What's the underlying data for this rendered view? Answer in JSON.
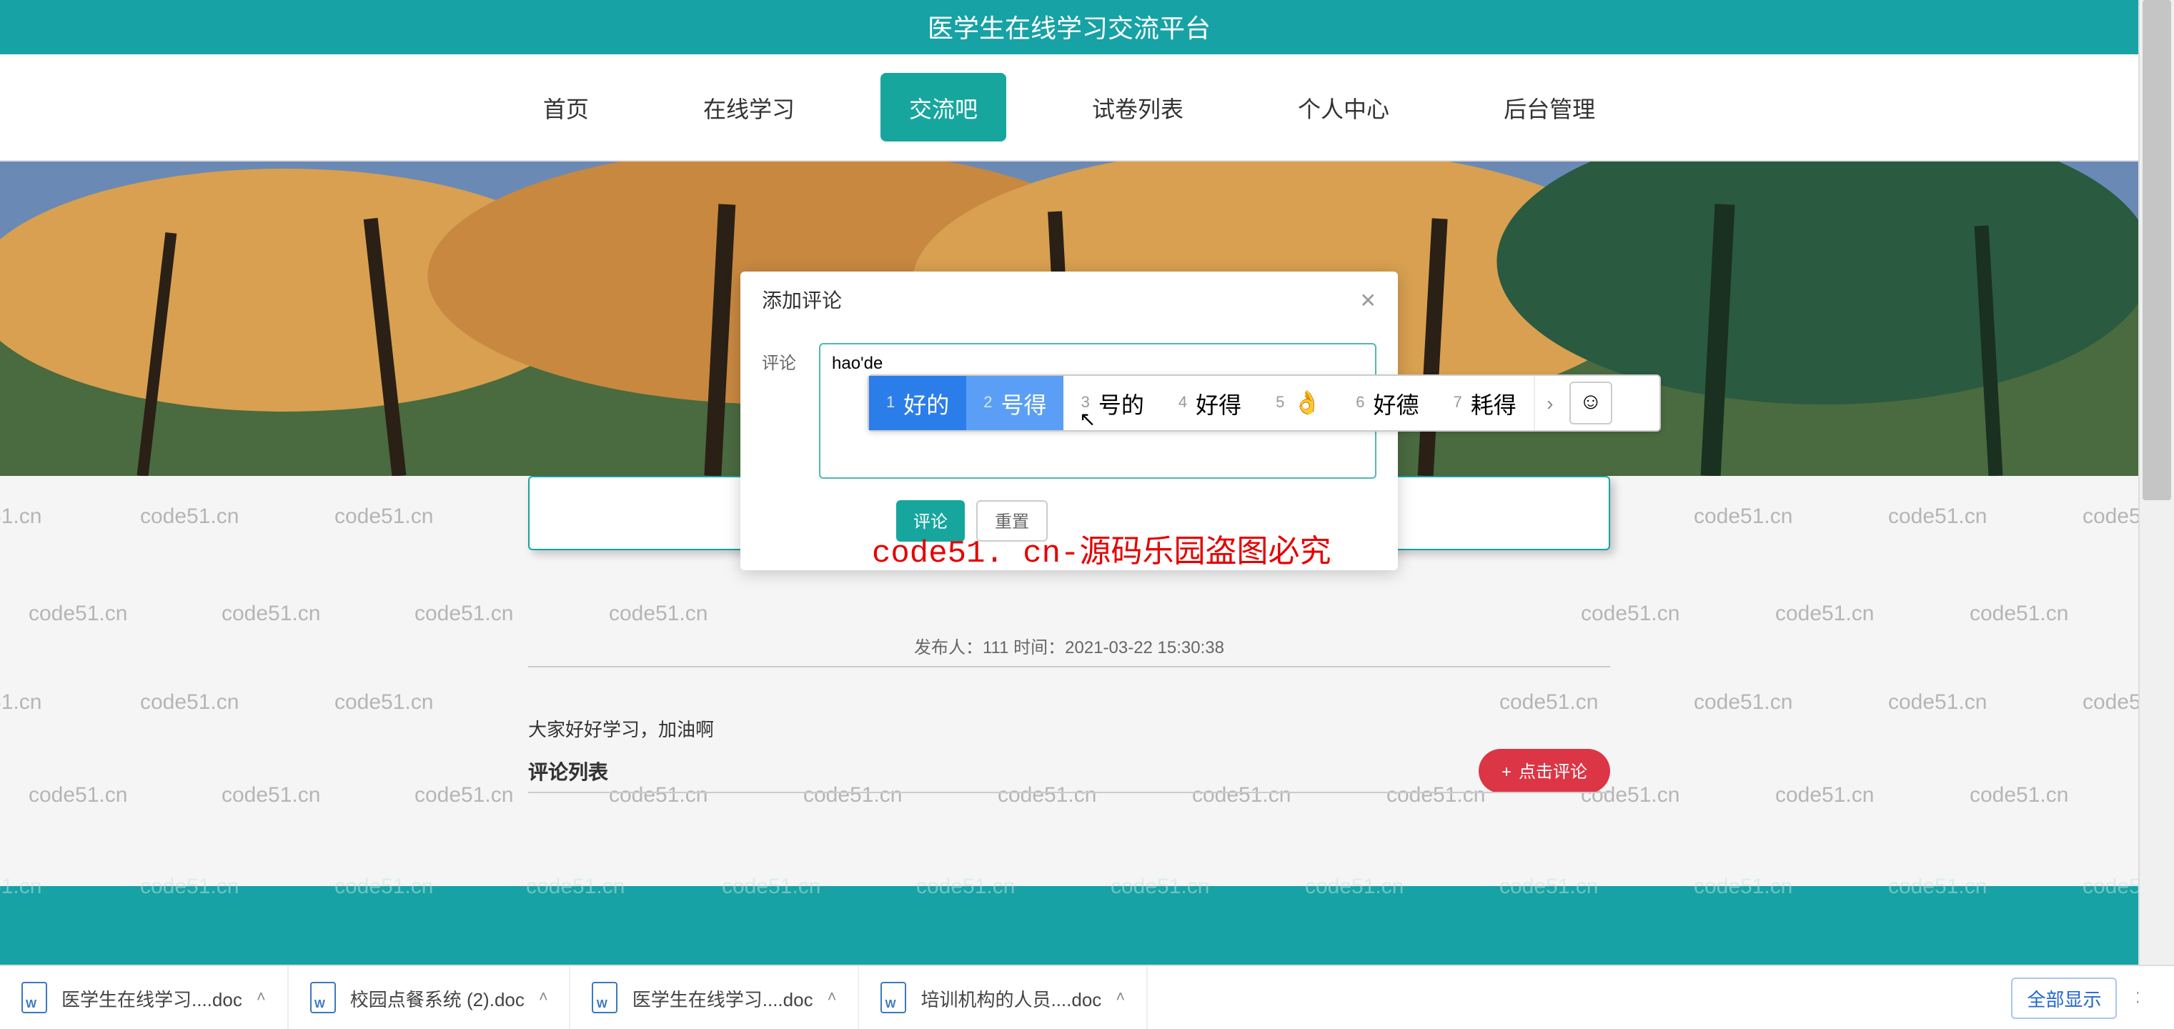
{
  "header": {
    "title": "医学生在线学习交流平台"
  },
  "nav": {
    "items": [
      {
        "label": "首页",
        "active": false
      },
      {
        "label": "在线学习",
        "active": false
      },
      {
        "label": "交流吧",
        "active": true
      },
      {
        "label": "试卷列表",
        "active": false
      },
      {
        "label": "个人中心",
        "active": false
      },
      {
        "label": "后台管理",
        "active": false
      }
    ]
  },
  "post": {
    "meta": "发布人：111 时间：2021-03-22 15:30:38",
    "content": "大家好好学习，加油啊",
    "comment_title": "评论列表",
    "comment_btn": "点击评论",
    "comment_btn_icon": "+"
  },
  "modal": {
    "title": "添加评论",
    "label": "评论",
    "textarea_value": "hao'de",
    "submit": "评论",
    "reset": "重置"
  },
  "watermark_text": "code51.cn",
  "watermark_red": "code51. cn-源码乐园盗图必究",
  "ime": {
    "candidates": [
      {
        "n": "1",
        "t": "好的"
      },
      {
        "n": "2",
        "t": "号得"
      },
      {
        "n": "3",
        "t": "号的"
      },
      {
        "n": "4",
        "t": "好得"
      },
      {
        "n": "5",
        "t": "👌"
      },
      {
        "n": "6",
        "t": "好德"
      },
      {
        "n": "7",
        "t": "耗得"
      }
    ],
    "emoji_btn": "☺"
  },
  "downloads": {
    "items": [
      "医学生在线学习....doc",
      "校园点餐系统 (2).doc",
      "医学生在线学习....doc",
      "培训机构的人员....doc"
    ],
    "show_all": "全部显示"
  },
  "chart_data": null
}
